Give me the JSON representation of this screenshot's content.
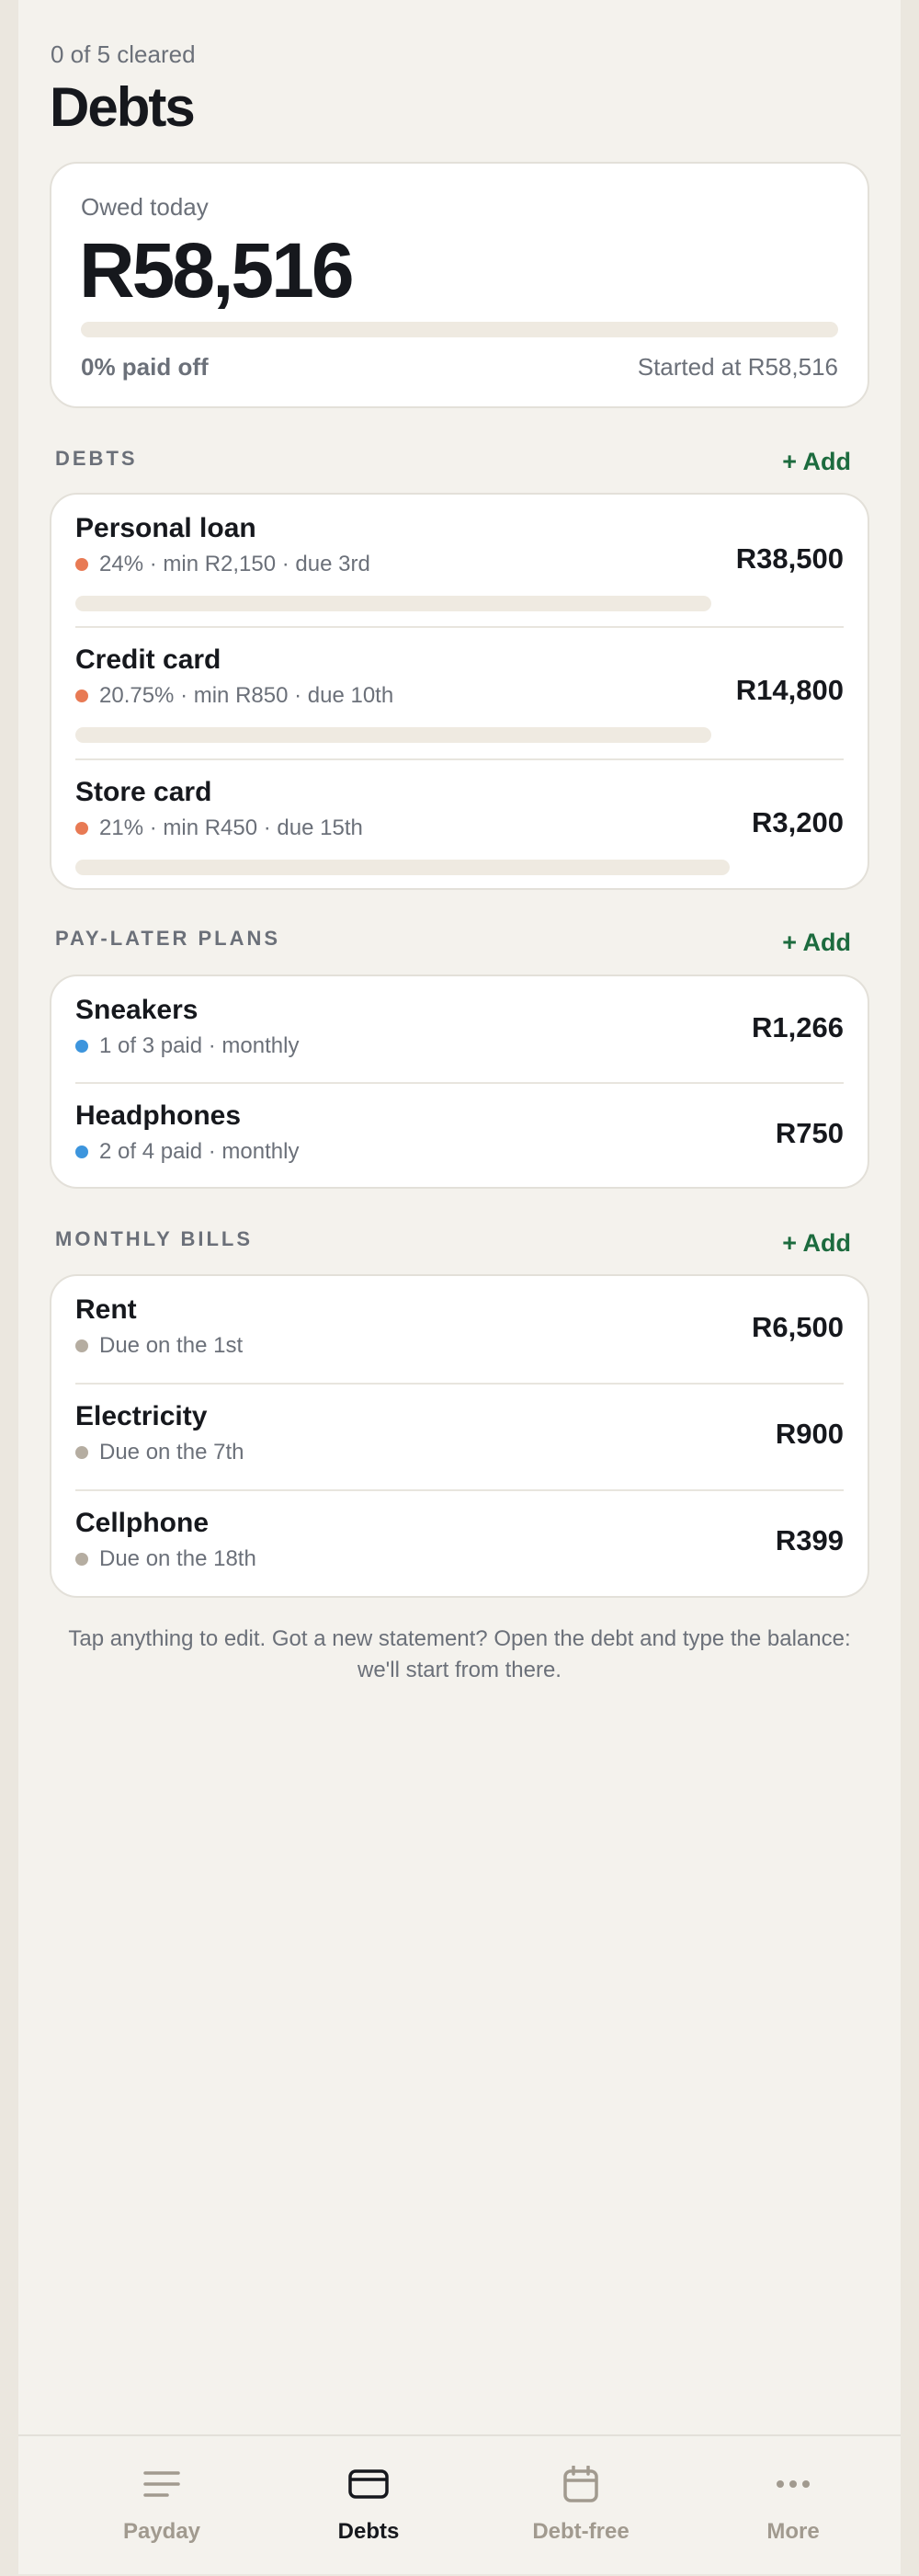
{
  "header": {
    "cleared_status": "0 of 5 cleared",
    "title": "Debts"
  },
  "summary": {
    "owed_label": "Owed today",
    "owed_amount": "R58,516",
    "progress_fraction": 0,
    "paid_off_text": "0% paid off",
    "started_text": "Started at R58,516"
  },
  "debts": {
    "heading": "DEBTS",
    "add_label": "+ Add",
    "items": [
      {
        "name": "Personal loan",
        "meta": "24% · min R2,150 · due 3rd",
        "amount": "R38,500"
      },
      {
        "name": "Credit card",
        "meta": "20.75% · min R850 · due 10th",
        "amount": "R14,800"
      },
      {
        "name": "Store card",
        "meta": "21% · min R450 · due 15th",
        "amount": "R3,200"
      }
    ]
  },
  "paylater": {
    "heading": "PAY-LATER PLANS",
    "add_label": "+ Add",
    "items": [
      {
        "name": "Sneakers",
        "meta": "1 of 3 paid · monthly",
        "amount": "R1,266"
      },
      {
        "name": "Headphones",
        "meta": "2 of 4 paid · monthly",
        "amount": "R750"
      }
    ]
  },
  "bills": {
    "heading": "MONTHLY BILLS",
    "add_label": "+ Add",
    "items": [
      {
        "name": "Rent",
        "meta": "Due on the 1st",
        "amount": "R6,500"
      },
      {
        "name": "Electricity",
        "meta": "Due on the 7th",
        "amount": "R900"
      },
      {
        "name": "Cellphone",
        "meta": "Due on the 18th",
        "amount": "R399"
      }
    ]
  },
  "footer_note": "Tap anything to edit. Got a new statement? Open the debt and type the balance: we'll start from there.",
  "tabs": [
    {
      "label": "Payday",
      "icon": "menu-icon"
    },
    {
      "label": "Debts",
      "icon": "card-icon"
    },
    {
      "label": "Debt-free",
      "icon": "calendar-icon"
    },
    {
      "label": "More",
      "icon": "more-dots-icon"
    }
  ],
  "colors": {
    "debt_dot": "#e87a54",
    "paylater_dot": "#3d95dd",
    "bill_dot": "#b5ada1",
    "accent_add": "#1c6b3e",
    "track": "#efeae1"
  }
}
